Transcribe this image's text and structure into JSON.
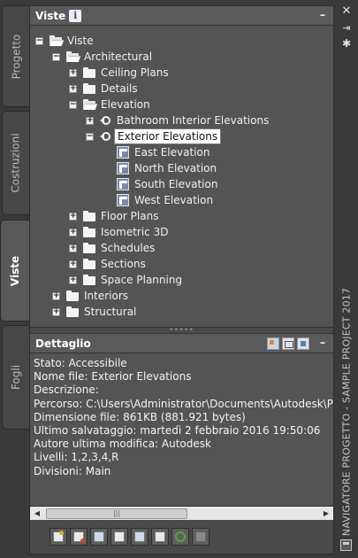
{
  "left_tabs": [
    {
      "label": "Progetto",
      "active": false
    },
    {
      "label": "Costruzioni",
      "active": false
    },
    {
      "label": "Viste",
      "active": true
    },
    {
      "label": "Fogli",
      "active": false
    }
  ],
  "viste_header": {
    "title": "Viste",
    "info_icon": "i",
    "collapse": "–"
  },
  "tree": {
    "root": "Viste",
    "architectural": "Architectural",
    "ceiling_plans": "Ceiling Plans",
    "details": "Details",
    "elevation": "Elevation",
    "bathroom_interior_elevations": "Bathroom Interior Elevations",
    "exterior_elevations": "Exterior Elevations",
    "east_elevation": "East Elevation",
    "north_elevation": "North Elevation",
    "south_elevation": "South Elevation",
    "west_elevation": "West Elevation",
    "floor_plans": "Floor Plans",
    "isometric_3d": "Isometric 3D",
    "schedules": "Schedules",
    "sections": "Sections",
    "space_planning": "Space Planning",
    "interiors": "Interiors",
    "structural": "Structural"
  },
  "dettaglio_header": {
    "title": "Dettaglio",
    "collapse": "–"
  },
  "details": [
    "Stato: Accessibile",
    "Nome file: Exterior Elevations",
    "Descrizione:",
    "Percorso: C:\\Users\\Administrator\\Documents\\Autodesk\\Progetti",
    "Dimensione file: 861KB (881.921 bytes)",
    "Ultimo salvataggio: martedì 2 febbraio 2016  19:50:06",
    "Autore ultima modifica: Autodesk",
    "Livelli: 1,2,3,4,R",
    "Divisioni: Main"
  ],
  "right_strip": {
    "close": "✕",
    "title": "NAVIGATORE PROGETTO - SAMPLE PROJECT 2017"
  }
}
